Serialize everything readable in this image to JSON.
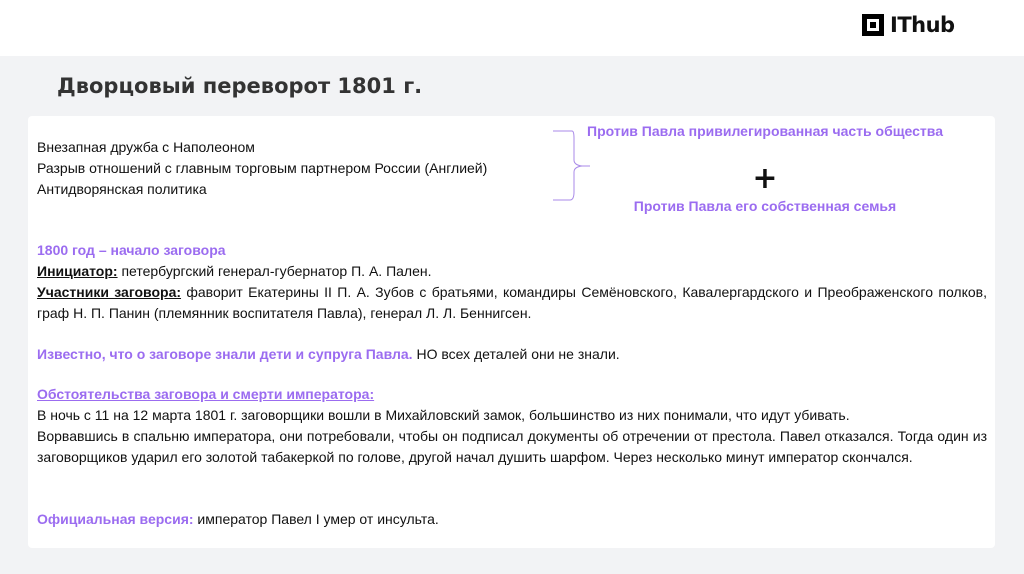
{
  "header": {
    "logo": "IThub",
    "title": "Дворцовый переворот 1801 г."
  },
  "causes": [
    "Внезапная дружба с Наполеоном",
    "Разрыв отношений с главным торговым партнером России (Англией)",
    "Антидворянская политика"
  ],
  "right": {
    "line1": "Против Павла привилегированная часть общества",
    "plus": "+",
    "line2": "Против Павла его собственная семья"
  },
  "plot": {
    "year": "1800 год – начало заговора",
    "initiator_label": "Инициатор:",
    "initiator": " петербургский генерал-губернатор П. А. Пален.",
    "participants_label": "Участники заговора:",
    "participants": " фаворит Екатерины II П. А. Зубов с братьями, командиры Семёновского, Кавалергардского и Преображенского полков, граф Н. П. Панин (племянник воспитателя Павла), генерал Л. Л. Беннигсен."
  },
  "known": {
    "purple": "Известно, что о заговоре знали дети и супруга Павла.",
    "rest": " НО всех деталей они не знали."
  },
  "circumstances": {
    "title": "Обстоятельства заговора и смерти императора:",
    "p1": "В ночь с 11 на 12 марта 1801 г. заговорщики вошли в Михайловский замок, большинство из них понимали, что идут убивать.",
    "p2": "Ворвавшись в спальню императора, они потребовали, чтобы он подписал документы об отречении от престола. Павел отказался. Тогда один из заговорщиков ударил его золотой табакеркой по голове, другой начал душить шарфом. Через несколько минут император скончался."
  },
  "official": {
    "label": "Официальная версия:",
    "text": " император Павел I умер от инсульта."
  }
}
